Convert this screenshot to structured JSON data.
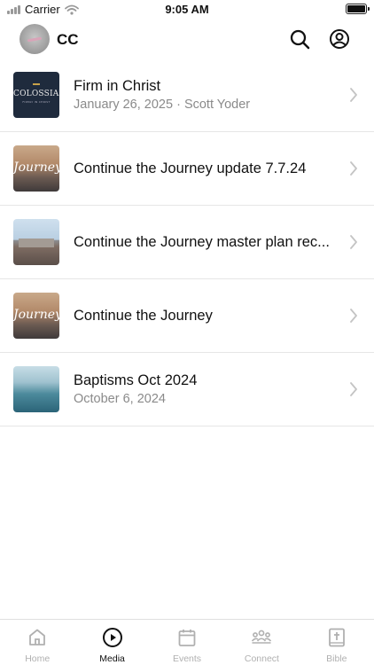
{
  "status_bar": {
    "carrier": "Carrier",
    "time": "9:05 AM"
  },
  "header": {
    "title": "CC"
  },
  "media_items": [
    {
      "title": "Firm in Christ",
      "subtitle": "January 26, 2025 · Scott Yoder",
      "thumb_text": "COLOSSIANS",
      "thumb_subtext": "FIRMLY IN CHRIST"
    },
    {
      "title": "Continue the Journey update 7.7.24",
      "subtitle": "",
      "thumb_text": "Journey"
    },
    {
      "title": "Continue the Journey master plan rec...",
      "subtitle": ""
    },
    {
      "title": "Continue the Journey",
      "subtitle": "",
      "thumb_text": "Journey"
    },
    {
      "title": "Baptisms Oct 2024",
      "subtitle": "October 6, 2024"
    }
  ],
  "tabs": [
    {
      "label": "Home",
      "icon": "home-icon",
      "active": false
    },
    {
      "label": "Media",
      "icon": "play-circle-icon",
      "active": true
    },
    {
      "label": "Events",
      "icon": "calendar-icon",
      "active": false
    },
    {
      "label": "Connect",
      "icon": "people-icon",
      "active": false
    },
    {
      "label": "Bible",
      "icon": "bible-icon",
      "active": false
    }
  ],
  "colors": {
    "accent_active": "#111111",
    "tab_inactive": "#b0b0b0",
    "subtitle": "#8a8a8a",
    "divider": "#e6e6e6"
  }
}
